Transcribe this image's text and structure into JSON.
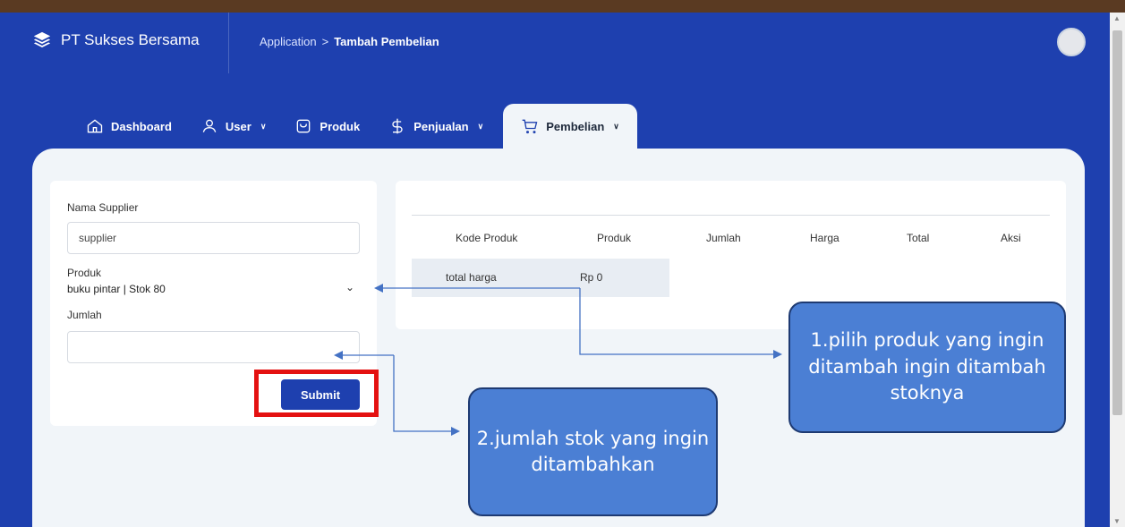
{
  "app": {
    "brand": "PT Sukses Bersama"
  },
  "breadcrumb": {
    "root": "Application",
    "separator": ">",
    "current": "Tambah Pembelian"
  },
  "nav": {
    "dashboard": "Dashboard",
    "user": "User",
    "produk": "Produk",
    "penjualan": "Penjualan",
    "pembelian": "Pembelian"
  },
  "form": {
    "supplier_label": "Nama Supplier",
    "supplier_value": "supplier",
    "produk_label": "Produk",
    "produk_selected": "buku pintar | Stok 80",
    "jumlah_label": "Jumlah",
    "jumlah_value": "",
    "submit_label": "Submit"
  },
  "table": {
    "headers": [
      "Kode Produk",
      "Produk",
      "Jumlah",
      "Harga",
      "Total",
      "Aksi"
    ],
    "total_label": "total harga",
    "total_value": "Rp 0"
  },
  "annotations": {
    "callout_1": "1.pilih produk yang ingin ditambah ingin ditambah stoknya",
    "callout_2": "2.jumlah stok yang ingin ditambahkan"
  },
  "colors": {
    "primary": "#1e40af",
    "highlight": "#e41111",
    "callout": "#4b7fd4"
  }
}
